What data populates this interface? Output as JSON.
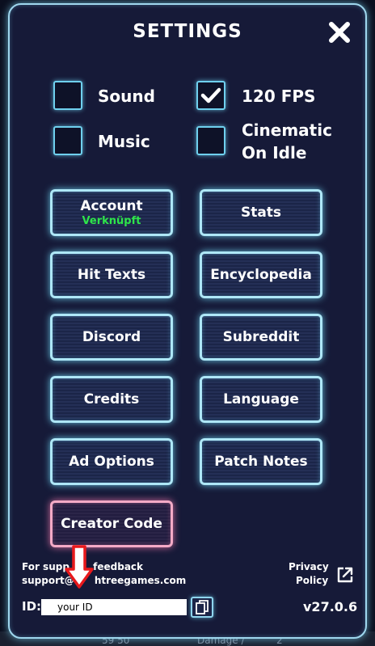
{
  "title": "SETTINGS",
  "options": {
    "sound": {
      "label": "Sound",
      "checked": false
    },
    "fps": {
      "label": "120 FPS",
      "checked": true
    },
    "music": {
      "label": "Music",
      "checked": false
    },
    "cinematic": {
      "label_line1": "Cinematic",
      "label_line2": "On Idle",
      "checked": false
    }
  },
  "buttons": {
    "account": {
      "label": "Account",
      "status": "Verknüpft"
    },
    "stats": "Stats",
    "hit_texts": "Hit Texts",
    "encyclopedia": "Encyclopedia",
    "discord": "Discord",
    "subreddit": "Subreddit",
    "credits": "Credits",
    "language": "Language",
    "ad_options": "Ad Options",
    "patch_notes": "Patch Notes",
    "creator_code": "Creator Code"
  },
  "footer": {
    "support_line1": "For supp       feedback",
    "support_line2": "support@      htreegames.com",
    "privacy_line1": "Privacy",
    "privacy_line2": "Policy",
    "id_label": "ID:",
    "id_value": "your ID",
    "version": "v27.0.6"
  },
  "background": {
    "text_left": "59 50",
    "text_right": "Damage /",
    "text_right2": "2"
  },
  "colors": {
    "panel_border": "#9fd7ee",
    "button_border": "#aee7f7",
    "creator_border": "#f3aac6",
    "status_green": "#2ee54a",
    "arrow_red": "#e8191c"
  },
  "icons": {
    "close": "close-icon",
    "check": "checkmark-icon",
    "external": "external-link-icon",
    "copy": "copy-icon",
    "annotation": "red-down-arrow"
  }
}
